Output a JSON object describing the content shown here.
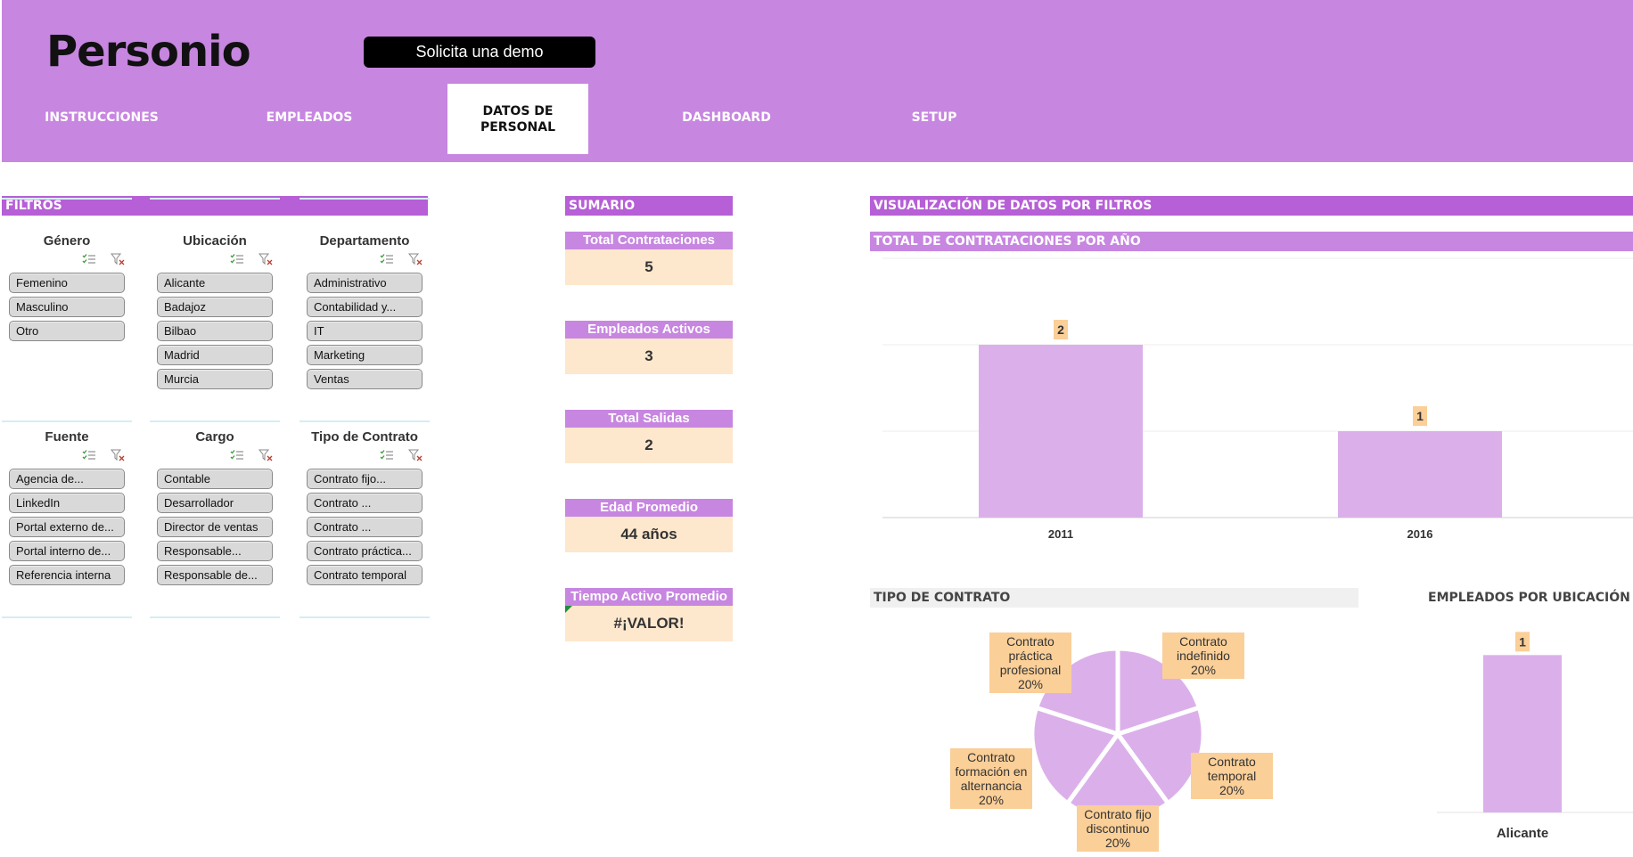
{
  "app": {
    "logo": "Personio",
    "demo_button": "Solicita una demo"
  },
  "tabs": [
    {
      "label": "INSTRUCCIONES",
      "active": false
    },
    {
      "label": "EMPLEADOS",
      "active": false
    },
    {
      "label": "DATOS DE PERSONAL",
      "active": true
    },
    {
      "label": "DASHBOARD",
      "active": false
    },
    {
      "label": "SETUP",
      "active": false
    }
  ],
  "filters": {
    "title": "FILTROS",
    "slicers": [
      {
        "title": "Género",
        "items": [
          "Femenino",
          "Masculino",
          "Otro"
        ]
      },
      {
        "title": "Ubicación",
        "items": [
          "Alicante",
          "Badajoz",
          "Bilbao",
          "Madrid",
          "Murcia"
        ]
      },
      {
        "title": "Departamento",
        "items": [
          "Administrativo",
          "Contabilidad y...",
          "IT",
          "Marketing",
          "Ventas"
        ]
      },
      {
        "title": "Fuente",
        "items": [
          "Agencia de...",
          "LinkedIn",
          "Portal externo de...",
          "Portal interno de...",
          "Referencia interna"
        ]
      },
      {
        "title": "Cargo",
        "items": [
          "Contable",
          "Desarrollador",
          "Director de ventas",
          "Responsable...",
          "Responsable de..."
        ]
      },
      {
        "title": "Tipo de Contrato",
        "items": [
          "Contrato fijo...",
          "Contrato ...",
          "Contrato ...",
          "Contrato práctica...",
          "Contrato temporal"
        ]
      }
    ]
  },
  "summary": {
    "title": "SUMARIO",
    "cards": [
      {
        "label": "Total Contrataciones",
        "value": "5"
      },
      {
        "label": "Empleados Activos",
        "value": "3"
      },
      {
        "label": "Total Salidas",
        "value": "2"
      },
      {
        "label": "Edad Promedio",
        "value": "44 años"
      },
      {
        "label": "Tiempo Activo Promedio",
        "value": "#¡VALOR!"
      }
    ]
  },
  "viz": {
    "title": "VISUALIZACIÓN DE DATOS POR FILTROS",
    "hires_title": "TOTAL DE CONTRATACIONES POR AÑO",
    "contract_title": "TIPO DE CONTRATO",
    "location_title": "EMPLEADOS POR UBICACIÓN"
  },
  "colors": {
    "header": "#c786e0",
    "section_bar": "#b65fd6",
    "bar_fill": "#dbb0ea",
    "label_bg": "#fbcf98",
    "card_value_bg": "#fde7cd"
  },
  "chart_data": [
    {
      "type": "bar",
      "title": "TOTAL DE CONTRATACIONES POR AÑO",
      "categories": [
        "2011",
        "2016"
      ],
      "values": [
        2,
        1
      ],
      "ylim": [
        0,
        3
      ],
      "grid": true
    },
    {
      "type": "pie",
      "title": "TIPO DE CONTRATO",
      "slices": [
        {
          "label": [
            "Contrato",
            "indefinido",
            "20%"
          ],
          "value": 20
        },
        {
          "label": [
            "Contrato",
            "temporal",
            "20%"
          ],
          "value": 20
        },
        {
          "label": [
            "Contrato fijo",
            "discontinuo",
            "20%"
          ],
          "value": 20
        },
        {
          "label": [
            "Contrato",
            "formación en",
            "alternancia",
            "20%"
          ],
          "value": 20
        },
        {
          "label": [
            "Contrato",
            "práctica",
            "profesional",
            "20%"
          ],
          "value": 20
        }
      ]
    },
    {
      "type": "bar",
      "title": "EMPLEADOS POR UBICACIÓN",
      "categories": [
        "Alicante"
      ],
      "values": [
        1
      ],
      "ylim": [
        0,
        1.2
      ]
    }
  ]
}
